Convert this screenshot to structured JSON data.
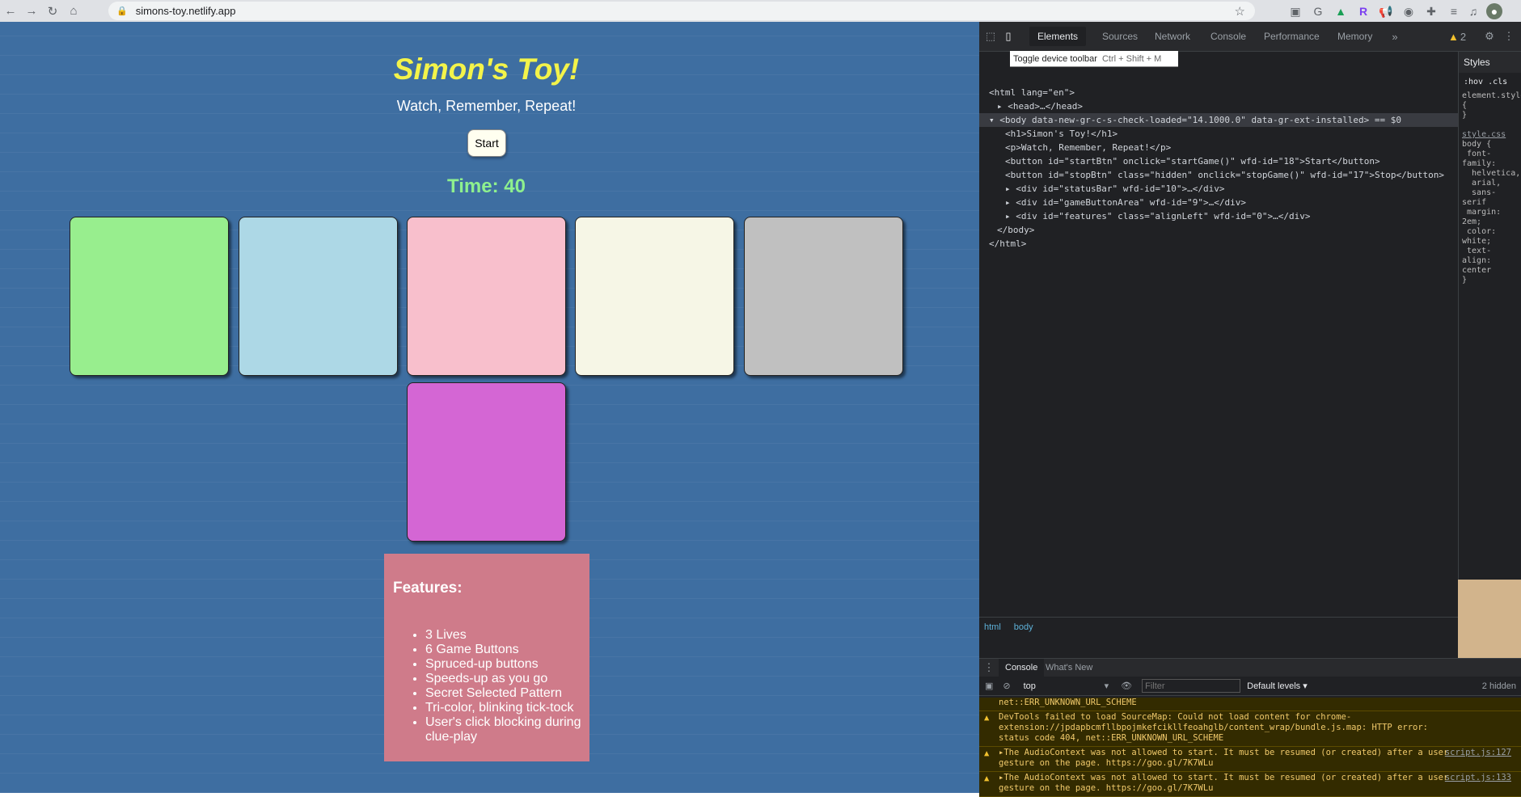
{
  "browser": {
    "url": "simons-toy.netlify.app"
  },
  "page": {
    "title": "Simon's Toy!",
    "tagline": "Watch, Remember, Repeat!",
    "start_label": "Start",
    "time_text": "Time: 40",
    "game_buttons": [
      {
        "color": "#98ee8e"
      },
      {
        "color": "#add8e6"
      },
      {
        "color": "#f8bfcc"
      },
      {
        "color": "#f6f6e6"
      },
      {
        "color": "#c0c0c0"
      },
      {
        "color": "#d466d4"
      }
    ],
    "features": {
      "heading": "Features:",
      "items": [
        "3 Lives",
        "6 Game Buttons",
        "Spruced-up buttons",
        "Speeds-up as you go",
        "Secret Selected Pattern",
        "Tri-color, blinking tick-tock",
        "User's click blocking during clue-play"
      ]
    }
  },
  "devtools": {
    "tabs": [
      "Elements",
      "Sources",
      "Network",
      "Console",
      "Performance",
      "Memory"
    ],
    "warning_count": "2",
    "tooltip": {
      "label": "Toggle device toolbar",
      "shortcut": "Ctrl + Shift + M"
    },
    "dom": [
      {
        "text": "<html lang=\"en\">",
        "indent": 0,
        "selected": false
      },
      {
        "text": "▸ <head>…</head>",
        "indent": 1,
        "selected": false
      },
      {
        "text": "▾ <body data-new-gr-c-s-check-loaded=\"14.1000.0\" data-gr-ext-installed> == $0",
        "indent": 0,
        "selected": true
      },
      {
        "text": "<h1>Simon's Toy!</h1>",
        "indent": 2,
        "selected": false
      },
      {
        "text": "<p>Watch, Remember, Repeat!</p>",
        "indent": 2,
        "selected": false
      },
      {
        "text": "<button id=\"startBtn\" onclick=\"startGame()\" wfd-id=\"18\">Start</button>",
        "indent": 2,
        "selected": false
      },
      {
        "text": "<button id=\"stopBtn\" class=\"hidden\" onclick=\"stopGame()\" wfd-id=\"17\">Stop</button>",
        "indent": 2,
        "selected": false
      },
      {
        "text": "▸ <div id=\"statusBar\" wfd-id=\"10\">…</div>",
        "indent": 2,
        "selected": false
      },
      {
        "text": "▸ <div id=\"gameButtonArea\" wfd-id=\"9\">…</div>",
        "indent": 2,
        "selected": false
      },
      {
        "text": "▸ <div id=\"features\" class=\"alignLeft\" wfd-id=\"0\">…</div>",
        "indent": 2,
        "selected": false
      },
      {
        "text": "</body>",
        "indent": 1,
        "selected": false
      },
      {
        "text": "</html>",
        "indent": 0,
        "selected": false
      }
    ],
    "styles_label": "Styles",
    "styles_filter": ":hov .cls",
    "breadcrumb": [
      "html",
      "body"
    ],
    "console": {
      "tabs": [
        "Console",
        "What's New"
      ],
      "context": "top",
      "filter_placeholder": "Filter",
      "levels": "Default levels ▾",
      "hidden": "2 hidden",
      "error_line": "net::ERR_UNKNOWN_URL_SCHEME",
      "messages": [
        {
          "text": "DevTools failed to load SourceMap: Could not load content for chrome-extension://jpdapbcmfllbpojmkefcikllfeoahglb/content_wrap/bundle.js.map: HTTP error: status code 404, net::ERR_UNKNOWN_URL_SCHEME",
          "source": ""
        },
        {
          "text": "▸The AudioContext was not allowed to start. It must be resumed (or created) after a user gesture on the page. https://goo.gl/7K7WLu",
          "source": "script.js:127"
        },
        {
          "text": "▸The AudioContext was not allowed to start. It must be resumed (or created) after a user gesture on the page. https://goo.gl/7K7WLu",
          "source": "script.js:133"
        }
      ]
    }
  }
}
